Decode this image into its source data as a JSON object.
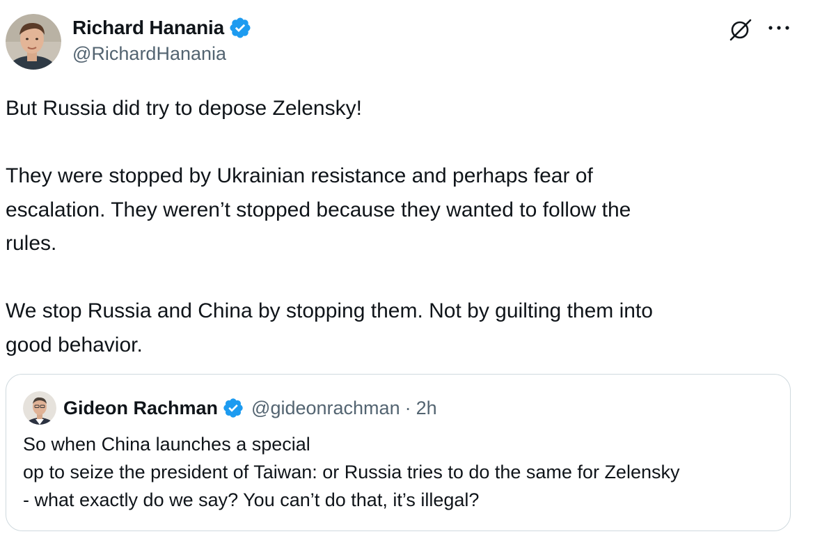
{
  "tweet": {
    "author": {
      "name": "Richard Hanania",
      "handle": "@RichardHanania"
    },
    "body": {
      "p1": "But Russia did try to depose Zelensky!",
      "p2_line1": "They were stopped by Ukrainian resistance and perhaps fear of",
      "p2_line2": "escalation. They weren’t stopped because they wanted to follow the",
      "p2_line3": "rules.",
      "p3_line1": "We stop Russia and China by stopping them. Not by guilting them into",
      "p3_line2": "good behavior."
    },
    "quote": {
      "name": "Gideon Rachman",
      "handle": "@gideonrachman",
      "separator": "·",
      "time": "2h",
      "line1": "So when China launches a special",
      "line2": "op to seize the president of Taiwan: or Russia tries to do the same for Zelensky",
      "line3": "- what exactly do we say? You can’t do that, it’s illegal?"
    }
  },
  "icons": {
    "verified": "verified-badge-icon",
    "grok": "grok-icon",
    "more": "more-options-icon"
  },
  "colors": {
    "text": "#0f1419",
    "secondary_text": "#536471",
    "verified_blue": "#1d9bf0",
    "card_border": "#cfd9de"
  }
}
